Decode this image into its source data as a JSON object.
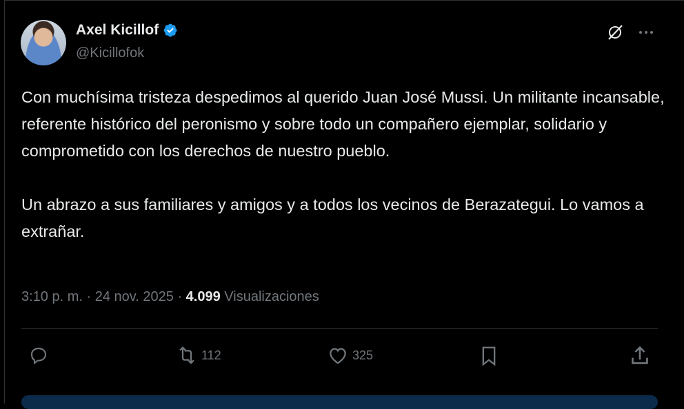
{
  "author": {
    "display_name": "Axel Kicillof",
    "handle": "@Kicillofok"
  },
  "tweet": {
    "paragraph_1": "Con muchísima tristeza despedimos al querido Juan José Mussi. Un militante incansable, referente histórico del peronismo y sobre todo un compañero ejemplar, solidario y comprometido con los derechos de nuestro pueblo.",
    "paragraph_2": "Un abrazo a sus familiares y amigos y a todos los vecinos de Berazategui. Lo vamos a extrañar."
  },
  "meta": {
    "time": "3:10 p. m.",
    "separator": " · ",
    "date": "24 nov. 2025",
    "views_count": "4.099",
    "views_label": "Visualizaciones"
  },
  "actions": {
    "reposts": "112",
    "likes": "325"
  },
  "icons": [
    "verified-badge-icon",
    "grok-icon",
    "more-icon",
    "reply-icon",
    "repost-icon",
    "like-icon",
    "bookmark-icon",
    "share-icon"
  ],
  "colors": {
    "background": "#000000",
    "text": "#e7e9ea",
    "muted": "#71767b",
    "verified": "#1d9bf0",
    "border": "#2f3336"
  }
}
